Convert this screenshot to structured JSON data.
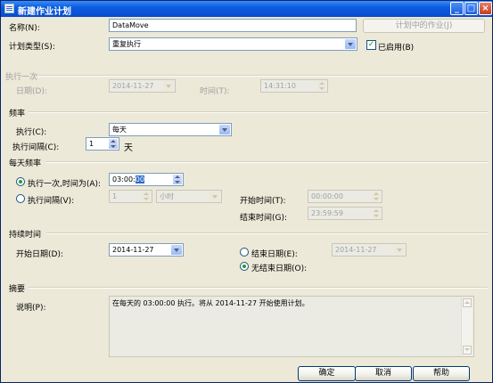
{
  "window": {
    "title": "新建作业计划",
    "minimize": "_",
    "maximize": "□",
    "close": "×"
  },
  "name": {
    "label": "名称(N):",
    "value": "DataMove"
  },
  "jobs_in_schedule_button": "计划中的作业(J)",
  "schedule_type": {
    "label": "计划类型(S):",
    "value": "重复执行"
  },
  "enabled": {
    "label": "已启用(B)",
    "checked": true
  },
  "one_time": {
    "section": "执行一次",
    "date_label": "日期(D):",
    "date_value": "2014-11-27",
    "time_label": "时间(T):",
    "time_value": "14:31:10"
  },
  "frequency": {
    "section": "频率",
    "occurs_label": "执行(C):",
    "occurs_value": "每天",
    "interval_label": "执行间隔(C):",
    "interval_value": "1",
    "interval_unit": "天"
  },
  "daily_frequency": {
    "section": "每天频率",
    "once_label": "执行一次,时间为(A):",
    "once_time_prefix": "03:00:",
    "once_time_selected": "00",
    "every_label": "执行间隔(V):",
    "every_value": "1",
    "every_unit": "小时",
    "start_label": "开始时间(T):",
    "start_value": "00:00:00",
    "end_label": "结束时间(G):",
    "end_value": "23:59:59"
  },
  "duration": {
    "section": "持续时间",
    "start_date_label": "开始日期(D):",
    "start_date_value": "2014-11-27",
    "end_date_label": "结束日期(E):",
    "end_date_value": "2014-11-27",
    "no_end_label": "无结束日期(O):"
  },
  "summary": {
    "section": "摘要",
    "desc_label": "说明(P):",
    "desc_value": "在每天的 03:00:00 执行。将从 2014-11-27 开始使用计划。"
  },
  "buttons": {
    "ok": "确定",
    "cancel": "取消",
    "help": "帮助"
  }
}
